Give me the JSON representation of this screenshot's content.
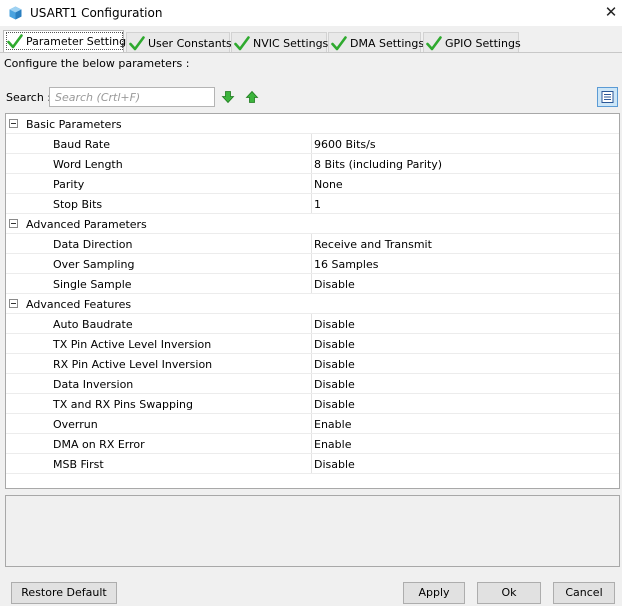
{
  "window": {
    "title": "USART1 Configuration",
    "close_glyph": "✕"
  },
  "tabs": [
    {
      "label": "Parameter Settings",
      "active": true,
      "icon": "check-icon"
    },
    {
      "label": "User Constants",
      "active": false,
      "icon": "check-icon"
    },
    {
      "label": "NVIC Settings",
      "active": false,
      "icon": "check-icon"
    },
    {
      "label": "DMA Settings",
      "active": false,
      "icon": "check-icon"
    },
    {
      "label": "GPIO Settings",
      "active": false,
      "icon": "check-icon"
    }
  ],
  "panel": {
    "description": "Configure the below parameters :",
    "search_label": "Search :",
    "search_placeholder": "Search (Crtl+F)",
    "search_value": ""
  },
  "groups": [
    {
      "label": "Basic Parameters",
      "params": [
        {
          "name": "Baud Rate",
          "value": "9600 Bits/s"
        },
        {
          "name": "Word Length",
          "value": "8 Bits (including Parity)"
        },
        {
          "name": "Parity",
          "value": "None"
        },
        {
          "name": "Stop Bits",
          "value": "1"
        }
      ]
    },
    {
      "label": "Advanced Parameters",
      "params": [
        {
          "name": "Data Direction",
          "value": "Receive and Transmit"
        },
        {
          "name": "Over Sampling",
          "value": "16 Samples"
        },
        {
          "name": "Single Sample",
          "value": "Disable"
        }
      ]
    },
    {
      "label": "Advanced Features",
      "params": [
        {
          "name": "Auto Baudrate",
          "value": "Disable"
        },
        {
          "name": "TX Pin Active Level Inversion",
          "value": "Disable"
        },
        {
          "name": "RX Pin Active Level Inversion",
          "value": "Disable"
        },
        {
          "name": "Data Inversion",
          "value": "Disable"
        },
        {
          "name": "TX and RX Pins Swapping",
          "value": "Disable"
        },
        {
          "name": "Overrun",
          "value": "Enable"
        },
        {
          "name": "DMA on RX Error",
          "value": "Enable"
        },
        {
          "name": "MSB First",
          "value": "Disable"
        }
      ]
    }
  ],
  "buttons": {
    "restore_default": "Restore Default",
    "apply": "Apply",
    "ok": "Ok",
    "cancel": "Cancel"
  },
  "colors": {
    "check": "#2faa2f",
    "arrow": "#3cb43c",
    "view_button": "#cde6f7"
  }
}
